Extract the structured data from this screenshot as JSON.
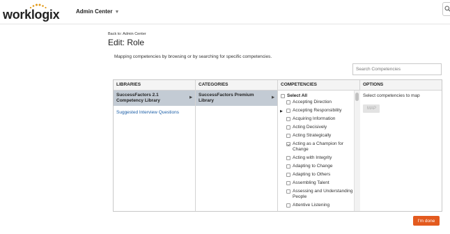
{
  "brand": {
    "logo_text_prefix": "work",
    "logo_text_accent": "logix",
    "logo_dot_color": "#e39b1b"
  },
  "header": {
    "admin_center_label": "Admin Center",
    "caret_icon": "chevron-down-icon",
    "search_icon": "search-icon"
  },
  "breadcrumb": {
    "back_label": "Back to: Admin Center"
  },
  "page": {
    "title": "Edit: Role",
    "instructions": "Mapping competencies by browsing or by searching for specific competencies."
  },
  "search": {
    "placeholder": "Search Competencies"
  },
  "columns": {
    "libraries": "LIBRARIES",
    "categories": "CATEGORIES",
    "competencies": "COMPETENCIES",
    "options": "OPTIONS"
  },
  "libraries": [
    {
      "label": "SuccessFactors 2.1 Competency Library",
      "selected": true
    },
    {
      "label": "Suggested Interview Questions",
      "selected": false
    }
  ],
  "categories": [
    {
      "label": "SuccessFactors Premium Library",
      "selected": true
    }
  ],
  "competencies": {
    "select_all_label": "Select All",
    "items": [
      {
        "label": "Accepting Direction",
        "checked": false
      },
      {
        "label": "Accepting Responsibility",
        "checked": false,
        "expanded_arrow": true
      },
      {
        "label": "Acquiring Information",
        "checked": false
      },
      {
        "label": "Acting Decisively",
        "checked": false
      },
      {
        "label": "Acting Strategically",
        "checked": false
      },
      {
        "label": "Acting as a Champion for Change",
        "checked": true
      },
      {
        "label": "Acting with Integrity",
        "checked": false
      },
      {
        "label": "Adapting to Change",
        "checked": false
      },
      {
        "label": "Adapting to Others",
        "checked": false
      },
      {
        "label": "Assembling Talent",
        "checked": false
      },
      {
        "label": "Assessing and Understanding People",
        "checked": false
      },
      {
        "label": "Attentive Listening",
        "checked": false
      }
    ]
  },
  "options": {
    "hint": "Select competencies to map",
    "map_button": "MAP"
  },
  "footer": {
    "done_button": "I'm done",
    "accent_color": "#e35a1e"
  }
}
